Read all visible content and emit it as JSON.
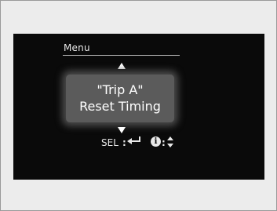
{
  "menu": {
    "title": "Menu"
  },
  "selected_item": {
    "line1": "\"Trip A\"",
    "line2": "Reset Timing"
  },
  "hint": {
    "sel_label": "SEL",
    "separator": ":",
    "select_icon": "enter-arrow-icon",
    "info_icon_glyph": "i",
    "scroll_icon": "up-down-arrows-icon"
  }
}
